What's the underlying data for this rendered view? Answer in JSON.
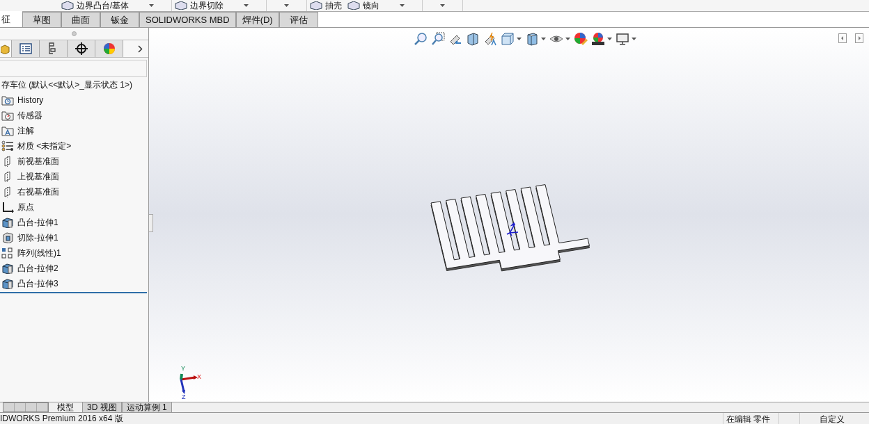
{
  "toolbar": [
    {
      "kind": "button",
      "label": "边界凸台/基体"
    },
    {
      "kind": "dropdown"
    },
    {
      "kind": "button",
      "label": "边界切除"
    },
    {
      "kind": "dropdown"
    },
    {
      "kind": "dropdown"
    },
    {
      "kind": "button",
      "label": "抽壳"
    },
    {
      "kind": "button",
      "label": "镜向"
    },
    {
      "kind": "dropdown"
    },
    {
      "kind": "dropdown"
    }
  ],
  "tabs": [
    {
      "label": "征",
      "selected": true
    },
    {
      "label": "草图",
      "selected": false
    },
    {
      "label": "曲面",
      "selected": false
    },
    {
      "label": "钣金",
      "selected": false
    },
    {
      "label": "SOLIDWORKS MBD",
      "selected": false
    },
    {
      "label": "焊件(D)",
      "selected": false
    },
    {
      "label": "评估",
      "selected": false
    }
  ],
  "panel_tabs": [
    {
      "kind": "feature",
      "selected": true
    },
    {
      "kind": "property",
      "selected": false
    },
    {
      "kind": "config",
      "selected": false
    },
    {
      "kind": "dimxpert",
      "selected": false
    },
    {
      "kind": "display",
      "selected": false
    }
  ],
  "feature_tree": {
    "root": "存车位 (默认<<默认>_显示状态 1>)",
    "items": [
      {
        "kind": "history",
        "label": "History"
      },
      {
        "kind": "sensor",
        "label": "传感器"
      },
      {
        "kind": "annotation",
        "label": "注解"
      },
      {
        "kind": "material",
        "label": "材质 <未指定>"
      },
      {
        "kind": "plane",
        "label": "前视基准面"
      },
      {
        "kind": "plane",
        "label": "上视基准面"
      },
      {
        "kind": "plane",
        "label": "右视基准面"
      },
      {
        "kind": "origin",
        "label": "原点"
      },
      {
        "kind": "boss",
        "label": "凸台-拉伸1"
      },
      {
        "kind": "cut",
        "label": "切除-拉伸1"
      },
      {
        "kind": "pattern",
        "label": "阵列(线性)1"
      },
      {
        "kind": "boss",
        "label": "凸台-拉伸2"
      },
      {
        "kind": "boss",
        "label": "凸台-拉伸3"
      }
    ]
  },
  "triad": {
    "x": "X",
    "y": "Y",
    "z": "Z"
  },
  "bottom_tabs": [
    {
      "label": "模型",
      "selected": true
    },
    {
      "label": "3D 视图",
      "selected": false
    },
    {
      "label": "运动算例 1",
      "selected": false
    }
  ],
  "status_bar": {
    "app": "IDWORKS Premium 2016 x64 版",
    "mode": "在编辑 零件",
    "units": "自定义"
  }
}
